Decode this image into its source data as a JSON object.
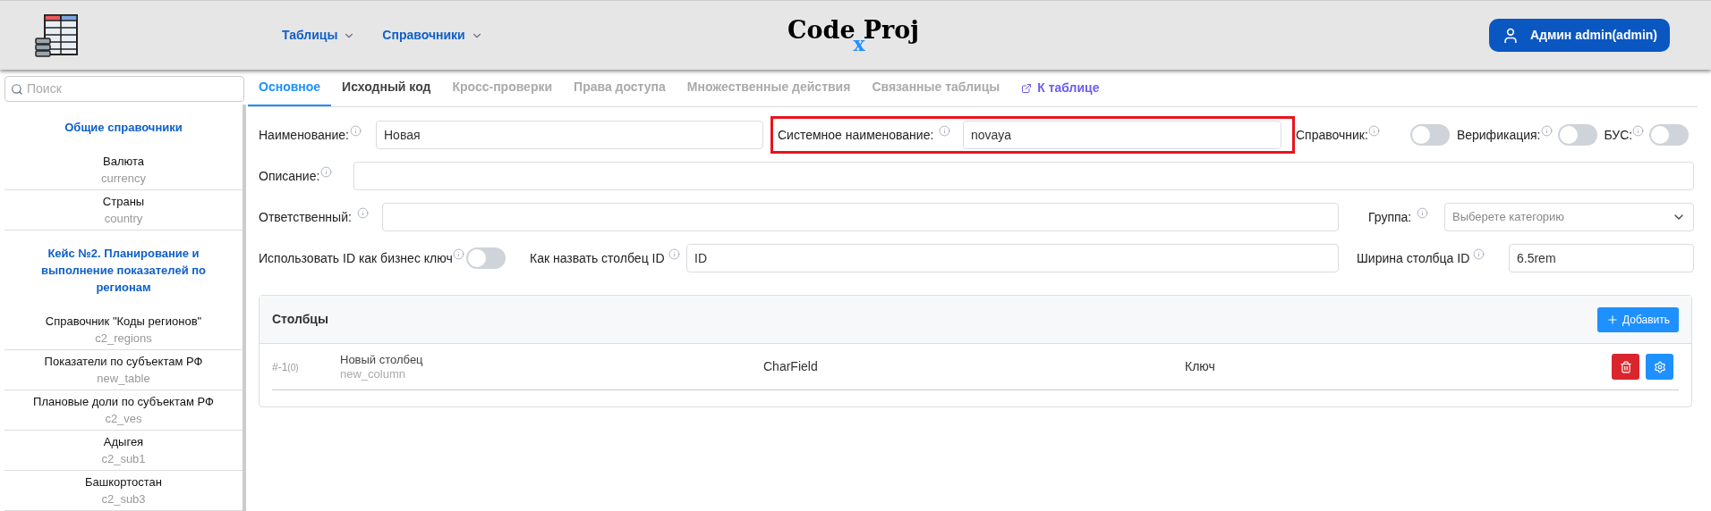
{
  "header": {
    "logo": {
      "left": "Code",
      "sub": "x",
      "right": "Proj"
    },
    "nav": [
      {
        "label": "Таблицы"
      },
      {
        "label": "Справочники"
      }
    ],
    "user_button": "Админ admin(admin)"
  },
  "sidebar": {
    "search": {
      "placeholder": "Поиск"
    },
    "groups": [
      {
        "title": "Общие справочники",
        "items": [
          {
            "name": "Валюта",
            "code": "currency"
          },
          {
            "name": "Страны",
            "code": "country"
          }
        ]
      },
      {
        "title": "Кейс №2. Планирование и выполнение показателей по регионам",
        "items": [
          {
            "name": "Справочник \"Коды регионов\"",
            "code": "c2_regions"
          },
          {
            "name": "Показатели по субъектам РФ",
            "code": "new_table"
          },
          {
            "name": "Плановые доли по субъектам РФ",
            "code": "c2_ves"
          },
          {
            "name": "Адыгея",
            "code": "c2_sub1"
          },
          {
            "name": "Башкортостан",
            "code": "c2_sub3"
          }
        ]
      }
    ]
  },
  "tabs": [
    {
      "kind": "tab",
      "label": "Основное",
      "selected": true,
      "disabled": false
    },
    {
      "kind": "tab",
      "label": "Исходный код",
      "selected": false,
      "disabled": false
    },
    {
      "kind": "tab",
      "label": "Кросс-проверки",
      "selected": false,
      "disabled": true
    },
    {
      "kind": "tab",
      "label": "Права доступа",
      "selected": false,
      "disabled": true
    },
    {
      "kind": "tab",
      "label": "Множественные действия",
      "selected": false,
      "disabled": true
    },
    {
      "kind": "tab",
      "label": "Связанные таблицы",
      "selected": false,
      "disabled": true
    },
    {
      "kind": "link",
      "label": "К таблице"
    }
  ],
  "form": {
    "name": {
      "label": "Наименование:",
      "value": "Новая"
    },
    "system_name": {
      "label": "Системное наименование:",
      "value": "novaya",
      "highlighted": true
    },
    "switches": [
      {
        "label": "Справочник:",
        "on": false
      },
      {
        "label": "Верификация:",
        "on": false
      },
      {
        "label": "БУС:",
        "on": false
      }
    ],
    "description": {
      "label": "Описание:"
    },
    "responsible": {
      "label": "Ответственный:"
    },
    "group": {
      "label": "Группа:",
      "placeholder": "Выберете категорию"
    },
    "id_business_key": {
      "label": "Использовать ID как бизнес ключ",
      "on": false
    },
    "id_column_name": {
      "label": "Как назвать столбец ID",
      "value": "ID"
    },
    "id_column_width": {
      "label": "Ширина столбца ID",
      "value": "6.5rem"
    }
  },
  "columns_card": {
    "title": "Столбцы",
    "add_button": "Добавить",
    "rows": [
      {
        "index": "#-1",
        "order": "(0)",
        "name": "Новый столбец",
        "code": "new_column",
        "type": "CharField",
        "role": "Ключ"
      }
    ]
  }
}
